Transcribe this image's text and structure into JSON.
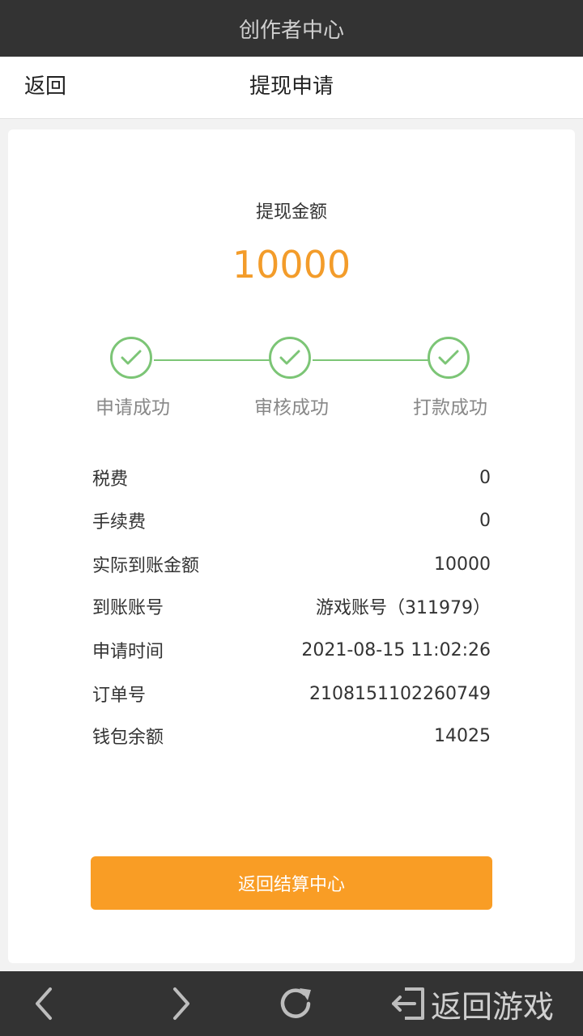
{
  "titlebar": {
    "title": "创作者中心"
  },
  "navbar": {
    "back_label": "返回",
    "title": "提现申请"
  },
  "amount": {
    "label": "提现金额",
    "value": "10000"
  },
  "steps": [
    {
      "label": "申请成功",
      "status": "done"
    },
    {
      "label": "审核成功",
      "status": "done"
    },
    {
      "label": "打款成功",
      "status": "done"
    }
  ],
  "details": [
    {
      "label": "税费",
      "value": "0"
    },
    {
      "label": "手续费",
      "value": "0"
    },
    {
      "label": "实际到账金额",
      "value": "10000"
    },
    {
      "label": "到账账号",
      "value": "游戏账号（311979）"
    },
    {
      "label": "申请时间",
      "value": "2021-08-15 11:02:26"
    },
    {
      "label": "订单号",
      "value": "2108151102260749"
    },
    {
      "label": "钱包余额",
      "value": "14025"
    }
  ],
  "button": {
    "label": "返回结算中心"
  },
  "bottombar": {
    "back_icon": "chevron-left-icon",
    "forward_icon": "chevron-right-icon",
    "refresh_icon": "refresh-icon",
    "exit_icon": "exit-icon",
    "return_game_label": "返回游戏"
  },
  "colors": {
    "accent": "#f99d25",
    "amount": "#f39c2a",
    "success": "#7cc576",
    "bar": "#333333"
  }
}
